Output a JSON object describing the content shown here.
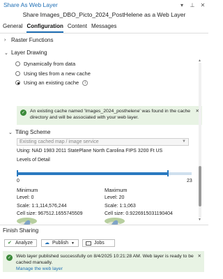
{
  "window": {
    "title": "Share As Web Layer",
    "menu_icon": "chevron-down",
    "pin_icon": "pin",
    "close_icon": "close"
  },
  "subtitle": "Share Images_DBO_Picto_2024_PostHelene as a Web Layer",
  "tabs": [
    {
      "label": "General",
      "active": false
    },
    {
      "label": "Configuration",
      "active": true
    },
    {
      "label": "Content",
      "active": false
    },
    {
      "label": "Messages",
      "active": false
    }
  ],
  "raster_functions": {
    "label": "Raster Functions",
    "expanded": false
  },
  "layer_drawing": {
    "label": "Layer Drawing",
    "expanded": true,
    "options": [
      {
        "label": "Dynamically from data",
        "selected": false
      },
      {
        "label": "Using tiles from a new cache",
        "selected": false
      },
      {
        "label": "Using an existing cache",
        "selected": true
      }
    ],
    "notice": "An existing cache named 'Images_2024_posthelene' was found in the cache directory and will be associated with your web layer."
  },
  "tiling_scheme": {
    "label": "Tiling Scheme",
    "expanded": true,
    "select_value": "Existing cached map / image service",
    "using": "Using:  NAD 1983 2011 StatePlane North Carolina FIPS 3200 Ft US",
    "levels_label": "Levels of Detail",
    "level_min_label": "0",
    "level_max_label": "23",
    "level_range": [
      0,
      23
    ],
    "selected_levels": [
      0,
      20
    ]
  },
  "minimum": {
    "heading": "Minimum",
    "level": "Level:  0",
    "scale": "Scale:  1:1,114,576,244",
    "cell_size": "Cell size:  967512.1655745509"
  },
  "maximum": {
    "heading": "Maximum",
    "level": "Level:  20",
    "scale": "Scale:  1:1,063",
    "cell_size": "Cell size:  0.9226915031190404"
  },
  "finish_sharing": {
    "label": "Finish Sharing",
    "analyze_label": "Analyze",
    "publish_label": "Publish",
    "jobs_label": "Jobs"
  },
  "success": {
    "message": "Web layer published successfully on 8/4/2025 10:21:28 AM. Web layer is ready to be cached manually.",
    "link_label": "Manage the web layer"
  },
  "colors": {
    "accent": "#1f6fb5",
    "success_bg": "#e8f3e4",
    "success_icon": "#3c8a3a"
  }
}
